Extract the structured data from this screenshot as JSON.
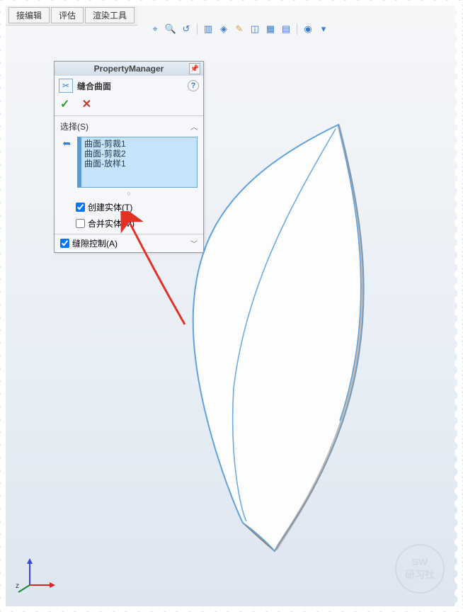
{
  "tabs": {
    "t1": "接编辑",
    "t2": "评估",
    "t3": "渲染工具"
  },
  "pm": {
    "title": "PropertyManager",
    "feature": "缝合曲面",
    "help": "?",
    "ok": "✓",
    "cancel": "✕",
    "section_select": "选择(S)",
    "list": [
      "曲面-剪裁1",
      "曲面-剪裁2",
      "曲面-放样1"
    ],
    "create_solid": "创建实体(T)",
    "merge_bodies": "合并实体(M)",
    "gap_control": "缝隙控制(A)"
  },
  "watermark": {
    "l1": "SW",
    "l2": "研习社"
  },
  "triad": {
    "z": "z"
  }
}
